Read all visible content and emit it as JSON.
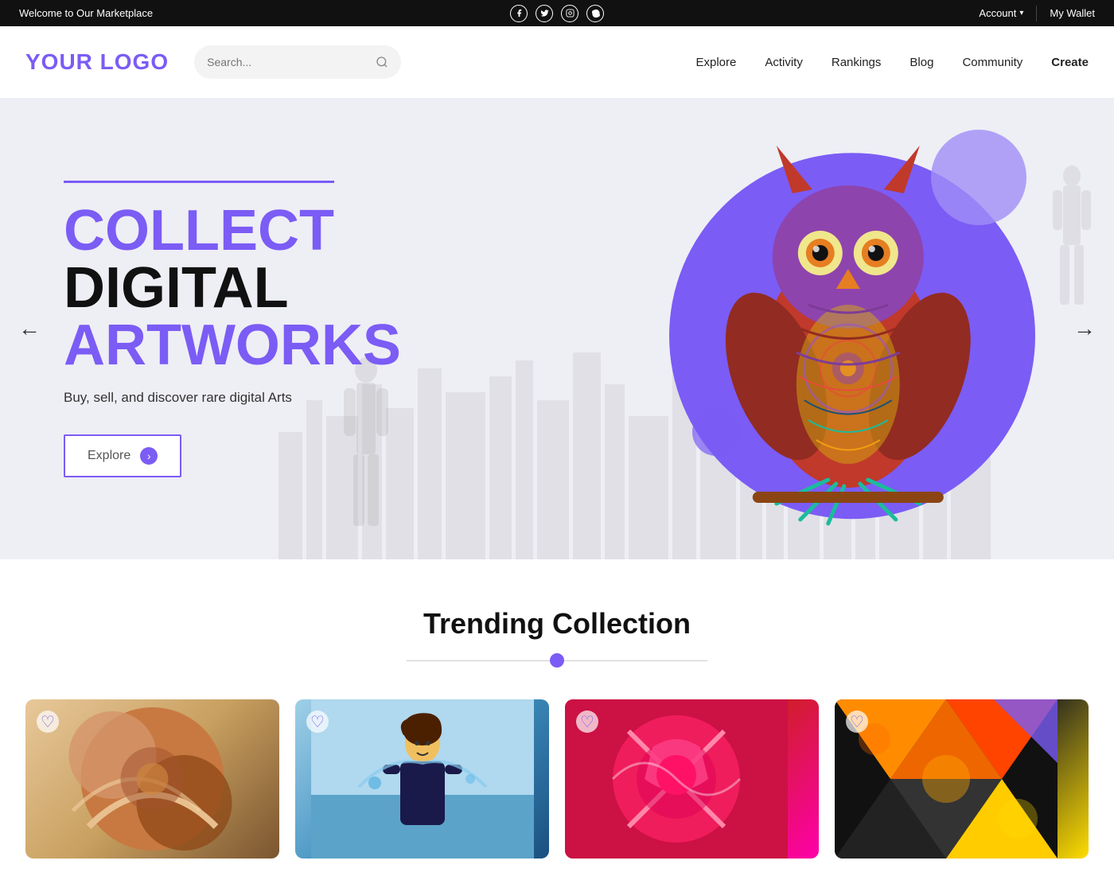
{
  "topbar": {
    "welcome": "Welcome to Our Marketplace",
    "account": "Account",
    "wallet": "My Wallet",
    "social": [
      {
        "name": "facebook",
        "symbol": "f"
      },
      {
        "name": "twitter",
        "symbol": "t"
      },
      {
        "name": "instagram",
        "symbol": "in"
      },
      {
        "name": "skype",
        "symbol": "s"
      }
    ]
  },
  "header": {
    "logo": "YOUR LOGO",
    "search_placeholder": "Search...",
    "nav": [
      {
        "label": "Explore"
      },
      {
        "label": "Activity"
      },
      {
        "label": "Rankings"
      },
      {
        "label": "Blog"
      },
      {
        "label": "Community"
      },
      {
        "label": "Create"
      }
    ]
  },
  "hero": {
    "line": "",
    "title_collect": "COLLECT",
    "title_digital": "DIGITAL",
    "title_artworks": "ARTWORKS",
    "subtitle": "Buy, sell, and discover rare digital Arts",
    "explore_btn": "Explore",
    "arrow": "›",
    "prev_arrow": "←",
    "next_arrow": "→"
  },
  "trending": {
    "title": "Trending Collection",
    "cards": [
      {
        "id": 1
      },
      {
        "id": 2
      },
      {
        "id": 3
      },
      {
        "id": 4
      }
    ]
  }
}
